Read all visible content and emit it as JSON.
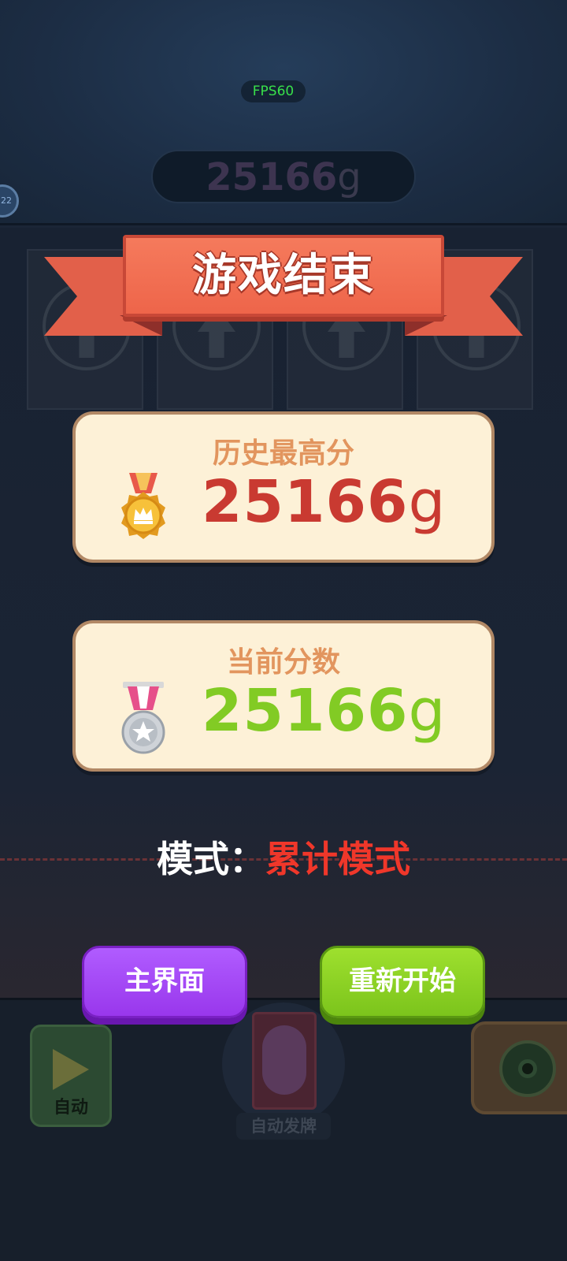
{
  "hud": {
    "fps_label": "FPS60",
    "top_score_number": "25166",
    "top_score_unit": "g",
    "level_text": "22"
  },
  "controls": {
    "auto_label": "自动",
    "deal_label": "自动发牌"
  },
  "game_over": {
    "title": "游戏结束",
    "best_label": "历史最高分",
    "best_score_number": "25166",
    "best_score_unit": "g",
    "current_label": "当前分数",
    "current_score_number": "25166",
    "current_score_unit": "g",
    "mode_key": "模式：",
    "mode_value": "累计模式",
    "home_button": "主界面",
    "restart_button": "重新开始"
  },
  "icons": {
    "gold_medal": "gold-crown-medal-icon",
    "silver_medal": "silver-star-medal-icon",
    "play": "play-icon",
    "settings": "gear-icon"
  },
  "colors": {
    "best_score": "#c93a31",
    "current_score": "#82cb24",
    "home_button": "#9937ec",
    "restart_button": "#7cc41c",
    "ribbon": "#ee654a",
    "mode_value": "#f0372a"
  }
}
